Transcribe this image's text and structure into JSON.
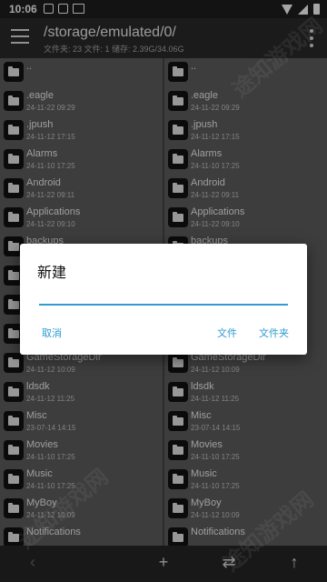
{
  "status_bar": {
    "time": "10:06",
    "left_icons": [
      "image-icon",
      "notification-icon",
      "keyboard-icon"
    ],
    "right_icons": [
      "wifi-icon",
      "signal-icon",
      "battery-icon"
    ]
  },
  "toolbar": {
    "path": "/storage/emulated/0/",
    "info": "文件夹: 23  文件: 1  储存: 2.39G/34.06G"
  },
  "left_pane": {
    "items": [
      {
        "name": "..",
        "date": ""
      },
      {
        "name": ".eagle",
        "date": "24-11-22 09:29"
      },
      {
        "name": ".jpush",
        "date": "24-11-12 17:15"
      },
      {
        "name": "Alarms",
        "date": "24-11-10 17:25"
      },
      {
        "name": "Android",
        "date": "24-11-22 09:11"
      },
      {
        "name": "Applications",
        "date": "24-11-22 09:10"
      },
      {
        "name": "backups",
        "date": ""
      },
      {
        "name": "",
        "date": ""
      },
      {
        "name": "",
        "date": ""
      },
      {
        "name": "",
        "date": ""
      },
      {
        "name": "GameStorageDir",
        "date": "24-11-12 10:09"
      },
      {
        "name": "ldsdk",
        "date": "24-11-12 11:25"
      },
      {
        "name": "Misc",
        "date": "23-07-14 14:15"
      },
      {
        "name": "Movies",
        "date": "24-11-10 17:25"
      },
      {
        "name": "Music",
        "date": "24-11-10 17:25"
      },
      {
        "name": "MyBoy",
        "date": "24-11-12 10:09"
      },
      {
        "name": "Notifications",
        "date": ""
      }
    ]
  },
  "right_pane": {
    "items": [
      {
        "name": "..",
        "date": ""
      },
      {
        "name": ".eagle",
        "date": "24-11-22 09:29"
      },
      {
        "name": ".jpush",
        "date": "24-11-12 17:15"
      },
      {
        "name": "Alarms",
        "date": "24-11-10 17:25"
      },
      {
        "name": "Android",
        "date": "24-11-22 09:11"
      },
      {
        "name": "Applications",
        "date": "24-11-22 09:10"
      },
      {
        "name": "backups",
        "date": ""
      },
      {
        "name": "",
        "date": ""
      },
      {
        "name": "",
        "date": ""
      },
      {
        "name": "",
        "date": ""
      },
      {
        "name": "GameStorageDir",
        "date": "24-11-12 10:09"
      },
      {
        "name": "ldsdk",
        "date": "24-11-12 11:25"
      },
      {
        "name": "Misc",
        "date": "23-07-14 14:15"
      },
      {
        "name": "Movies",
        "date": "24-11-10 17:25"
      },
      {
        "name": "Music",
        "date": "24-11-10 17:25"
      },
      {
        "name": "MyBoy",
        "date": "24-11-12 10:09"
      },
      {
        "name": "Notifications",
        "date": ""
      }
    ]
  },
  "bottom_bar": {
    "back_icon": "‹",
    "add_icon": "+",
    "swap_icon": "⇄",
    "up_icon": "↑"
  },
  "dialog": {
    "title": "新建",
    "input_value": "",
    "cancel_label": "取消",
    "file_label": "文件",
    "folder_label": "文件夹"
  },
  "watermark": {
    "text": "途知游戏网"
  },
  "colors": {
    "accent": "#2f9bd1",
    "toolbar_bg": "#2a2a2a",
    "pane_bg": "#5e5e5e"
  }
}
